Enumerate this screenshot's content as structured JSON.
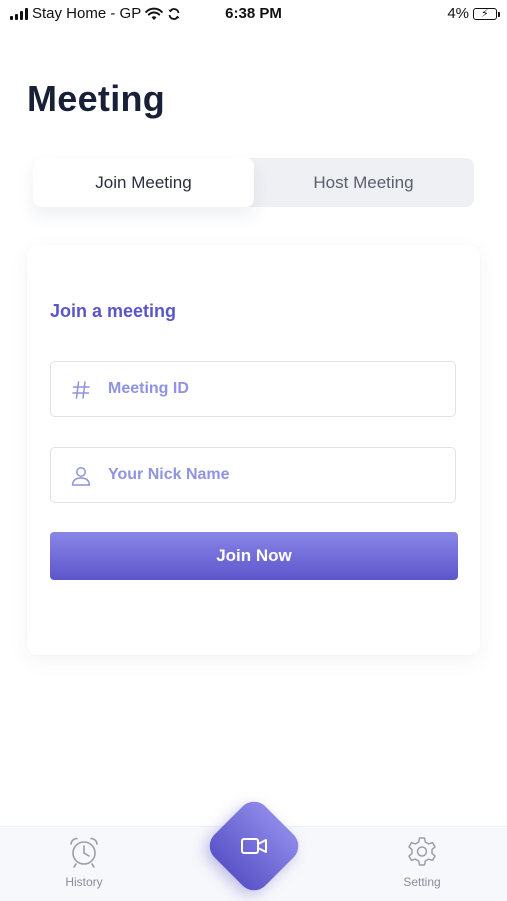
{
  "status_bar": {
    "carrier": "Stay Home - GP",
    "time": "6:38 PM",
    "battery": "4%"
  },
  "page": {
    "title": "Meeting"
  },
  "tabs": [
    {
      "label": "Join Meeting",
      "active": true
    },
    {
      "label": "Host Meeting",
      "active": false
    }
  ],
  "join_form": {
    "title": "Join a meeting",
    "meeting_id": {
      "placeholder": "Meeting ID",
      "value": "",
      "icon": "hash-icon"
    },
    "nickname": {
      "placeholder": "Your Nick Name",
      "value": "",
      "icon": "user-icon"
    },
    "submit_label": "Join Now"
  },
  "bottom_nav": {
    "history_label": "History",
    "setting_label": "Setting",
    "center_icon": "video-camera-icon"
  },
  "colors": {
    "accent": "#5f5ace",
    "title": "#172036",
    "placeholder": "#8f93e0"
  }
}
